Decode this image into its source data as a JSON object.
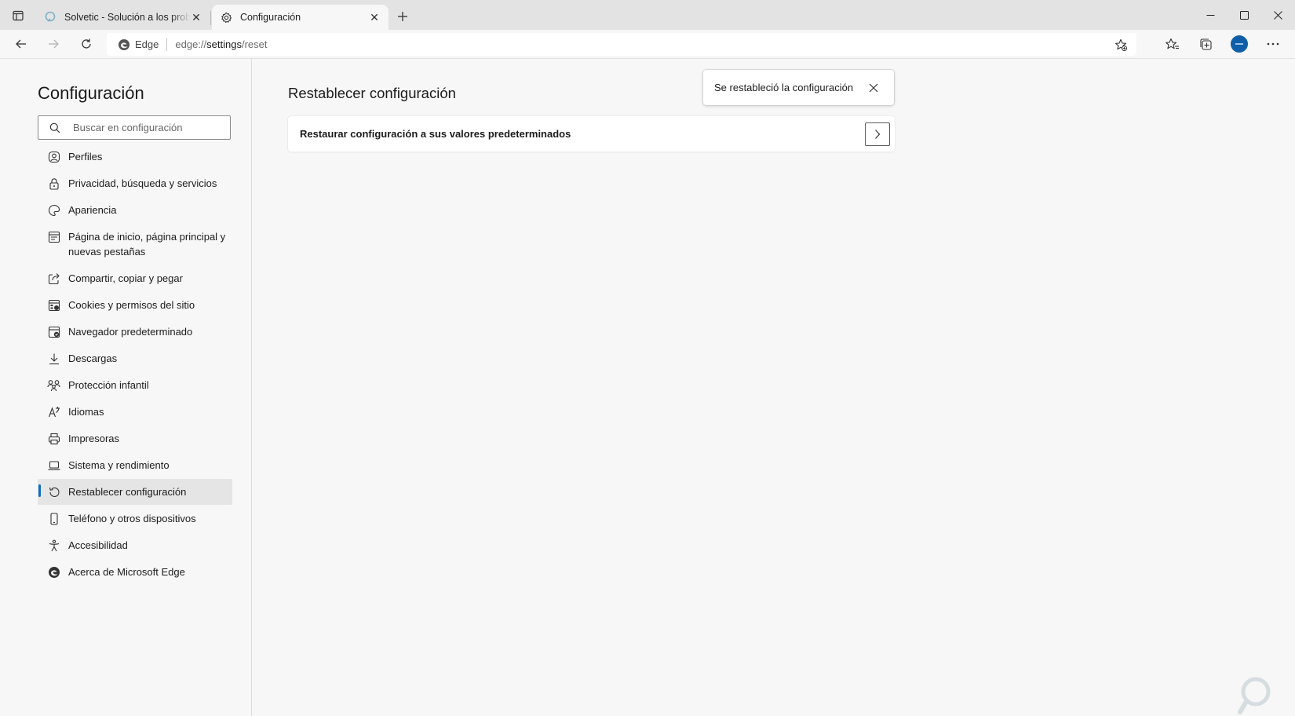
{
  "tabs": [
    {
      "title": "Solvetic - Solución a los problemas",
      "icon": "solvetic-favicon-icon",
      "active": false
    },
    {
      "title": "Configuración",
      "icon": "gear-icon",
      "active": true
    }
  ],
  "toolbar": {
    "site_label": "Edge",
    "url_prefix": "edge://",
    "url_host": "settings",
    "url_path": "/reset"
  },
  "sidebar": {
    "title": "Configuración",
    "search_placeholder": "Buscar en configuración",
    "items": [
      {
        "label": "Perfiles",
        "icon": "profile-icon"
      },
      {
        "label": "Privacidad, búsqueda y servicios",
        "icon": "lock-icon"
      },
      {
        "label": "Apariencia",
        "icon": "palette-icon"
      },
      {
        "label": "Página de inicio, página principal y nuevas pestañas",
        "icon": "home-page-icon"
      },
      {
        "label": "Compartir, copiar y pegar",
        "icon": "share-icon"
      },
      {
        "label": "Cookies y permisos del sitio",
        "icon": "site-permissions-icon"
      },
      {
        "label": "Navegador predeterminado",
        "icon": "default-browser-icon"
      },
      {
        "label": "Descargas",
        "icon": "download-icon"
      },
      {
        "label": "Protección infantil",
        "icon": "family-icon"
      },
      {
        "label": "Idiomas",
        "icon": "language-icon"
      },
      {
        "label": "Impresoras",
        "icon": "printer-icon"
      },
      {
        "label": "Sistema y rendimiento",
        "icon": "laptop-icon"
      },
      {
        "label": "Restablecer configuración",
        "icon": "reset-icon",
        "active": true
      },
      {
        "label": "Teléfono y otros dispositivos",
        "icon": "phone-icon"
      },
      {
        "label": "Accesibilidad",
        "icon": "accessibility-icon"
      },
      {
        "label": "Acerca de Microsoft Edge",
        "icon": "edge-logo-icon"
      }
    ]
  },
  "main": {
    "title": "Restablecer configuración",
    "card_label": "Restaurar configuración a sus valores predeterminados",
    "toast_text": "Se restableció la configuración"
  },
  "colors": {
    "accent": "#0f6cbd",
    "avatar": "#0f5fa8",
    "page_bg": "#f7f7f7",
    "tabstrip_bg": "#e3e3e3"
  }
}
